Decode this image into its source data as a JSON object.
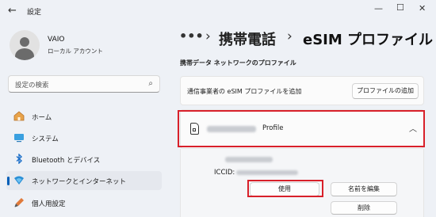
{
  "window": {
    "title": "設定",
    "back_glyph": "←",
    "minimize_glyph": "—",
    "maximize_glyph": "☐",
    "close_glyph": "✕"
  },
  "user": {
    "name": "VAIO",
    "account": "ローカル アカウント"
  },
  "search": {
    "placeholder": "設定の検索",
    "icon": "search-icon"
  },
  "sidebar": {
    "items": [
      {
        "label": "ホーム",
        "icon": "home-icon",
        "selected": false
      },
      {
        "label": "システム",
        "icon": "system-icon",
        "selected": false
      },
      {
        "label": "Bluetooth とデバイス",
        "icon": "bluetooth-icon",
        "selected": false
      },
      {
        "label": "ネットワークとインターネット",
        "icon": "network-icon",
        "selected": true
      },
      {
        "label": "個人用設定",
        "icon": "personalization-icon",
        "selected": false
      }
    ]
  },
  "breadcrumb": {
    "more": "•••",
    "separator": "›",
    "parent": "携帯電話",
    "current": "eSIM プロファイル"
  },
  "section": {
    "title": "携帯データ ネットワークのプロファイル"
  },
  "add_profile": {
    "text": "通信事業者の eSIM プロファイルを追加",
    "button": "プロファイルの追加"
  },
  "profile": {
    "name_suffix": "Profile",
    "chevron": "︿",
    "iccid_label": "ICCID:",
    "use_button": "使用",
    "rename_button": "名前を編集",
    "delete_button": "削除"
  },
  "colors": {
    "accent": "#005fb8",
    "highlight": "#d8202a",
    "background": "#eef1f6"
  }
}
